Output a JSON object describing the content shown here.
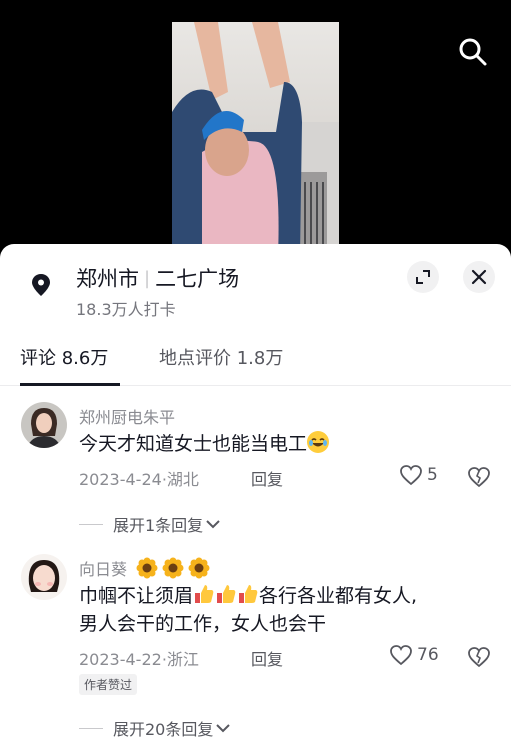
{
  "location": {
    "city": "郑州市",
    "place": "二七广场",
    "checkins": "18.3万人打卡"
  },
  "tabs": [
    {
      "label": "评论 8.6万",
      "active": true
    },
    {
      "label": "地点评价 1.8万",
      "active": false
    }
  ],
  "comments": [
    {
      "user": "郑州厨电朱平",
      "text": "今天才知道女士也能当电工",
      "emoji": "rolling-laughing-face",
      "date": "2023-4-24",
      "region": "湖北",
      "reply_label": "回复",
      "likes": "5",
      "expand_label": "展开1条回复"
    },
    {
      "user": "向日葵",
      "user_emoji": "sunflower-x3",
      "text_line1_a": "巾帼不让须眉",
      "text_line1_b": "各行各业都有女人,",
      "text_line2": "男人会干的工作，女人也会干",
      "date": "2023-4-22",
      "region": "浙江",
      "reply_label": "回复",
      "likes": "76",
      "badge": "作者赞过",
      "expand_label": "展开20条回复"
    }
  ],
  "colors": {
    "accent_text": "#161823",
    "secondary_text": "#8a8b91",
    "surface": "#ffffff",
    "chip_bg": "#f1f1f2"
  }
}
